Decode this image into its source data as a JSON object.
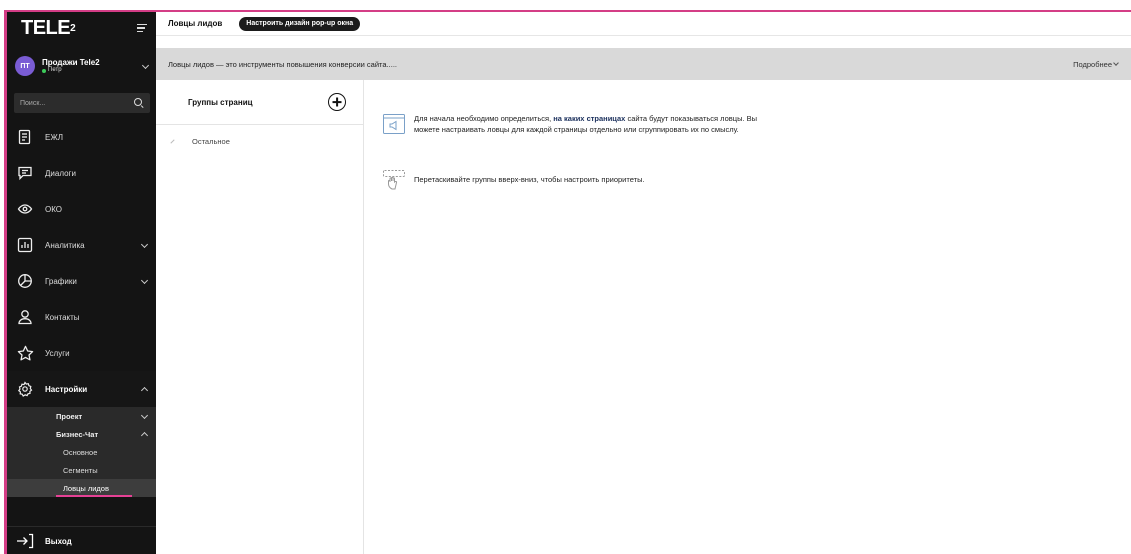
{
  "brand": {
    "logo_text": "TELE2",
    "logo_part1": "TELE",
    "logo_part2": "2"
  },
  "account": {
    "initials": "ПТ",
    "name": "Продажи Tele2",
    "user": "Петр"
  },
  "search": {
    "placeholder": "Поиск..."
  },
  "menu": {
    "ejl": "ЕЖЛ",
    "dialogs": "Диалоги",
    "oko": "ОКО",
    "analytics": "Аналитика",
    "charts": "Графики",
    "contacts": "Контакты",
    "services": "Услуги",
    "settings": "Настройки"
  },
  "settings_sub": {
    "project": "Проект",
    "business_chat": "Бизнес-Чат",
    "basic": "Основное",
    "segments": "Сегменты",
    "lead_catchers": "Ловцы лидов"
  },
  "logout": "Выход",
  "topbar": {
    "title": "Ловцы лидов",
    "design_button": "Настроить дизайн pop-up окна"
  },
  "infobar": {
    "text": "Ловцы лидов — это инструменты повышения конверсии сайта.....",
    "more": "Подробнее"
  },
  "groups": {
    "title": "Группы страниц",
    "items": [
      "Остальное"
    ]
  },
  "hints": {
    "first_pre": "Для начала необходимо определиться, ",
    "first_bold": "на каких страницах",
    "first_post": " сайта будут показываться ловцы. Вы можете настраивать ловцы для каждой страницы отдельно или сгруппировать их по смыслу.",
    "second": "Перетаскивайте группы вверх-вниз, чтобы настроить приоритеты."
  },
  "colors": {
    "sidebar_bg": "#141414",
    "accent_pink": "#e64195",
    "frame": "#d43d86",
    "avatar": "#7a5cd4",
    "online": "#3ccb5a"
  }
}
